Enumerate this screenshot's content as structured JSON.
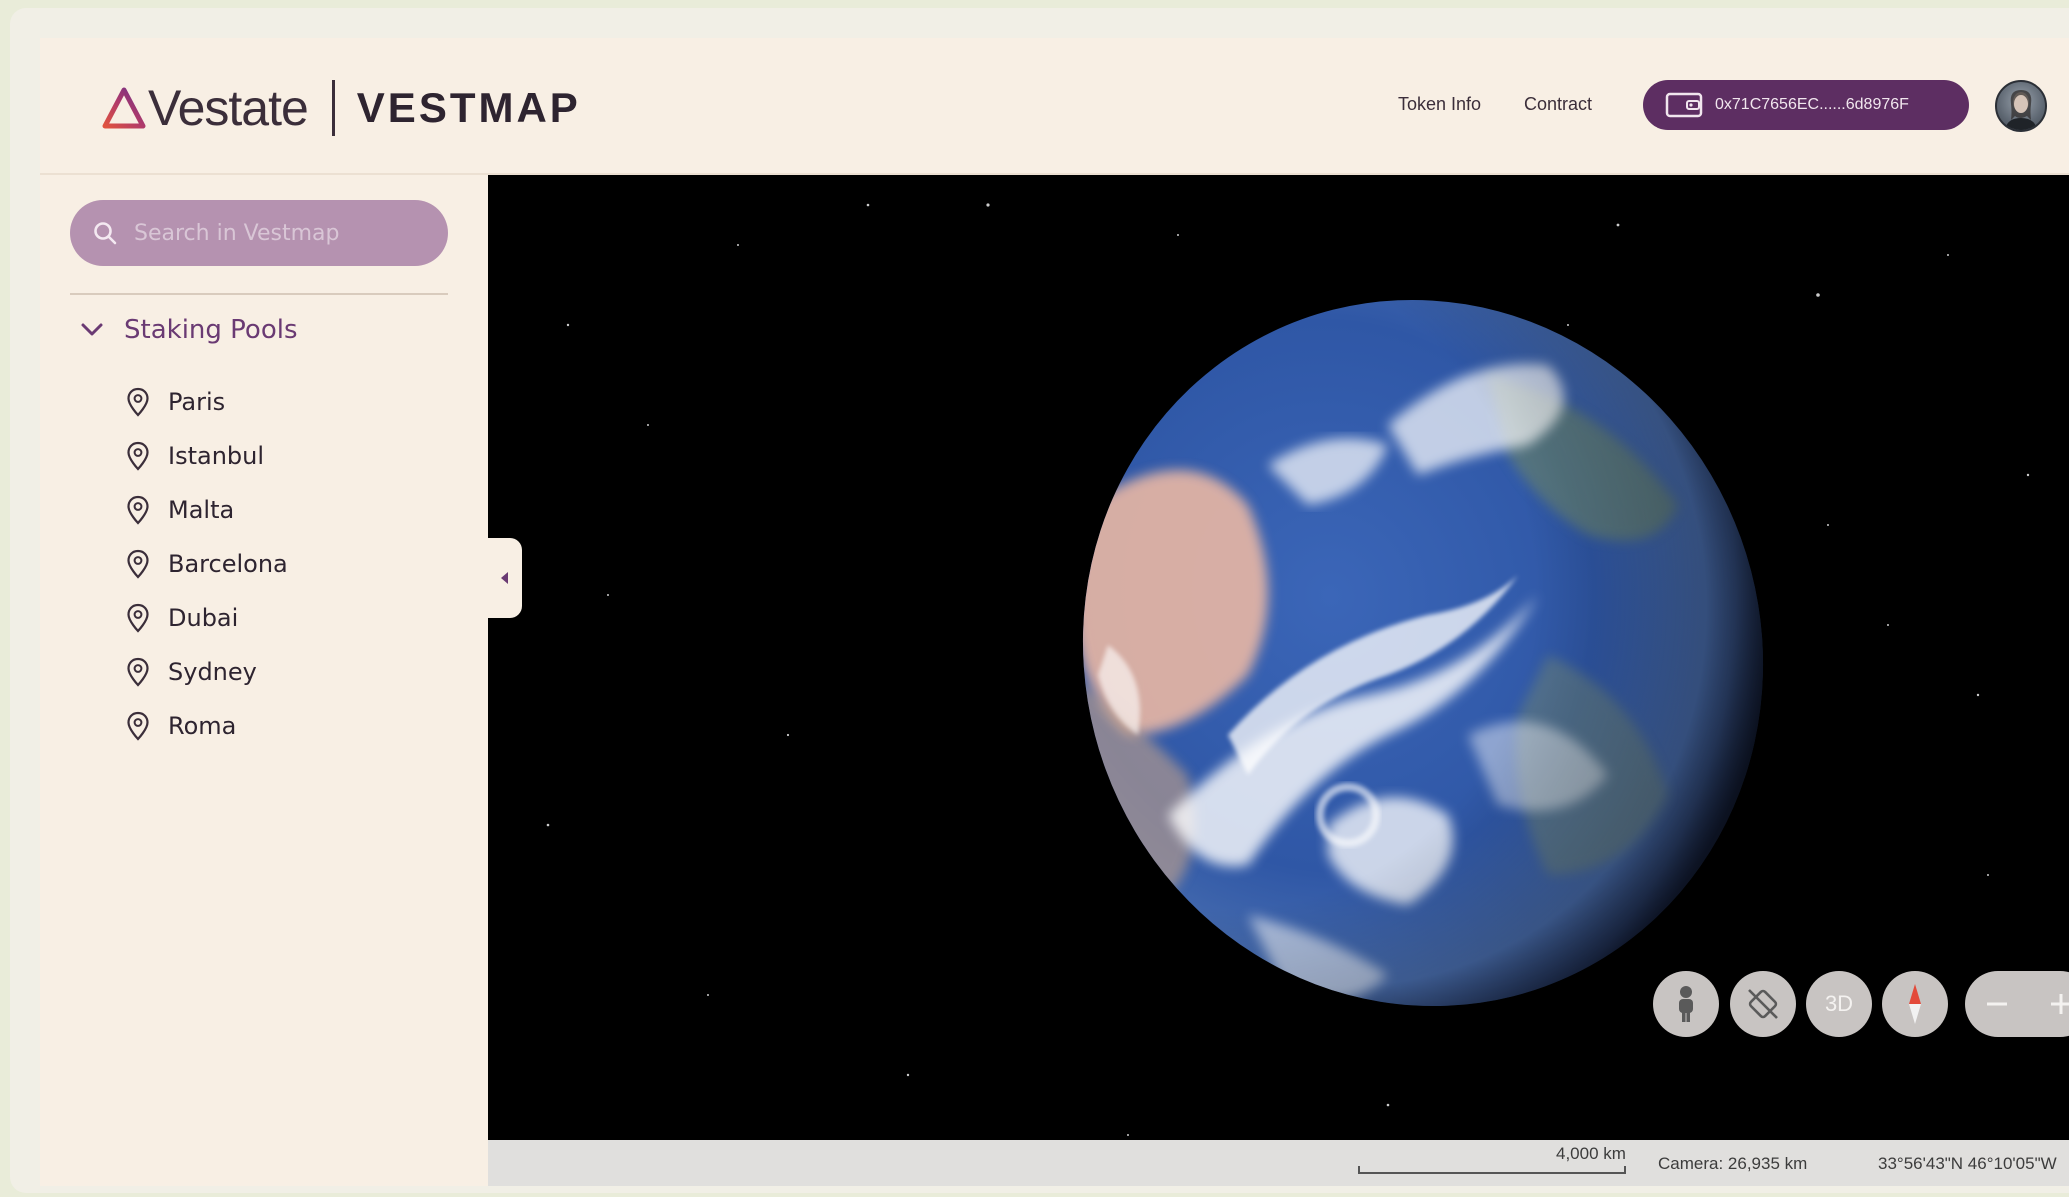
{
  "header": {
    "brand": "Vestate",
    "product": "VESTMAP",
    "nav": [
      "Token Info",
      "Contract"
    ],
    "wallet_address": "0x71C7656EC......6d8976F",
    "wallet_icon": "wallet-icon",
    "accent_color": "#5d2e62"
  },
  "sidebar": {
    "search_placeholder": "Search in Vestmap",
    "section_title": "Staking Pools",
    "pools": [
      "Paris",
      "Istanbul",
      "Malta",
      "Barcelona",
      "Dubai",
      "Sydney",
      "Roma"
    ],
    "pool_icon": "location-pin-icon"
  },
  "map": {
    "controls": {
      "pegman": "pegman-icon",
      "rotate": "rotate-off-icon",
      "mode_3d": "3D",
      "compass": "compass-icon",
      "zoom_out": "zoom-out-icon",
      "zoom_in": "zoom-in-icon"
    },
    "status": {
      "scale": "4,000 km",
      "camera": "Camera: 26,935 km",
      "coordinates": "33°56'43\"N 46°10'05\"W"
    }
  }
}
